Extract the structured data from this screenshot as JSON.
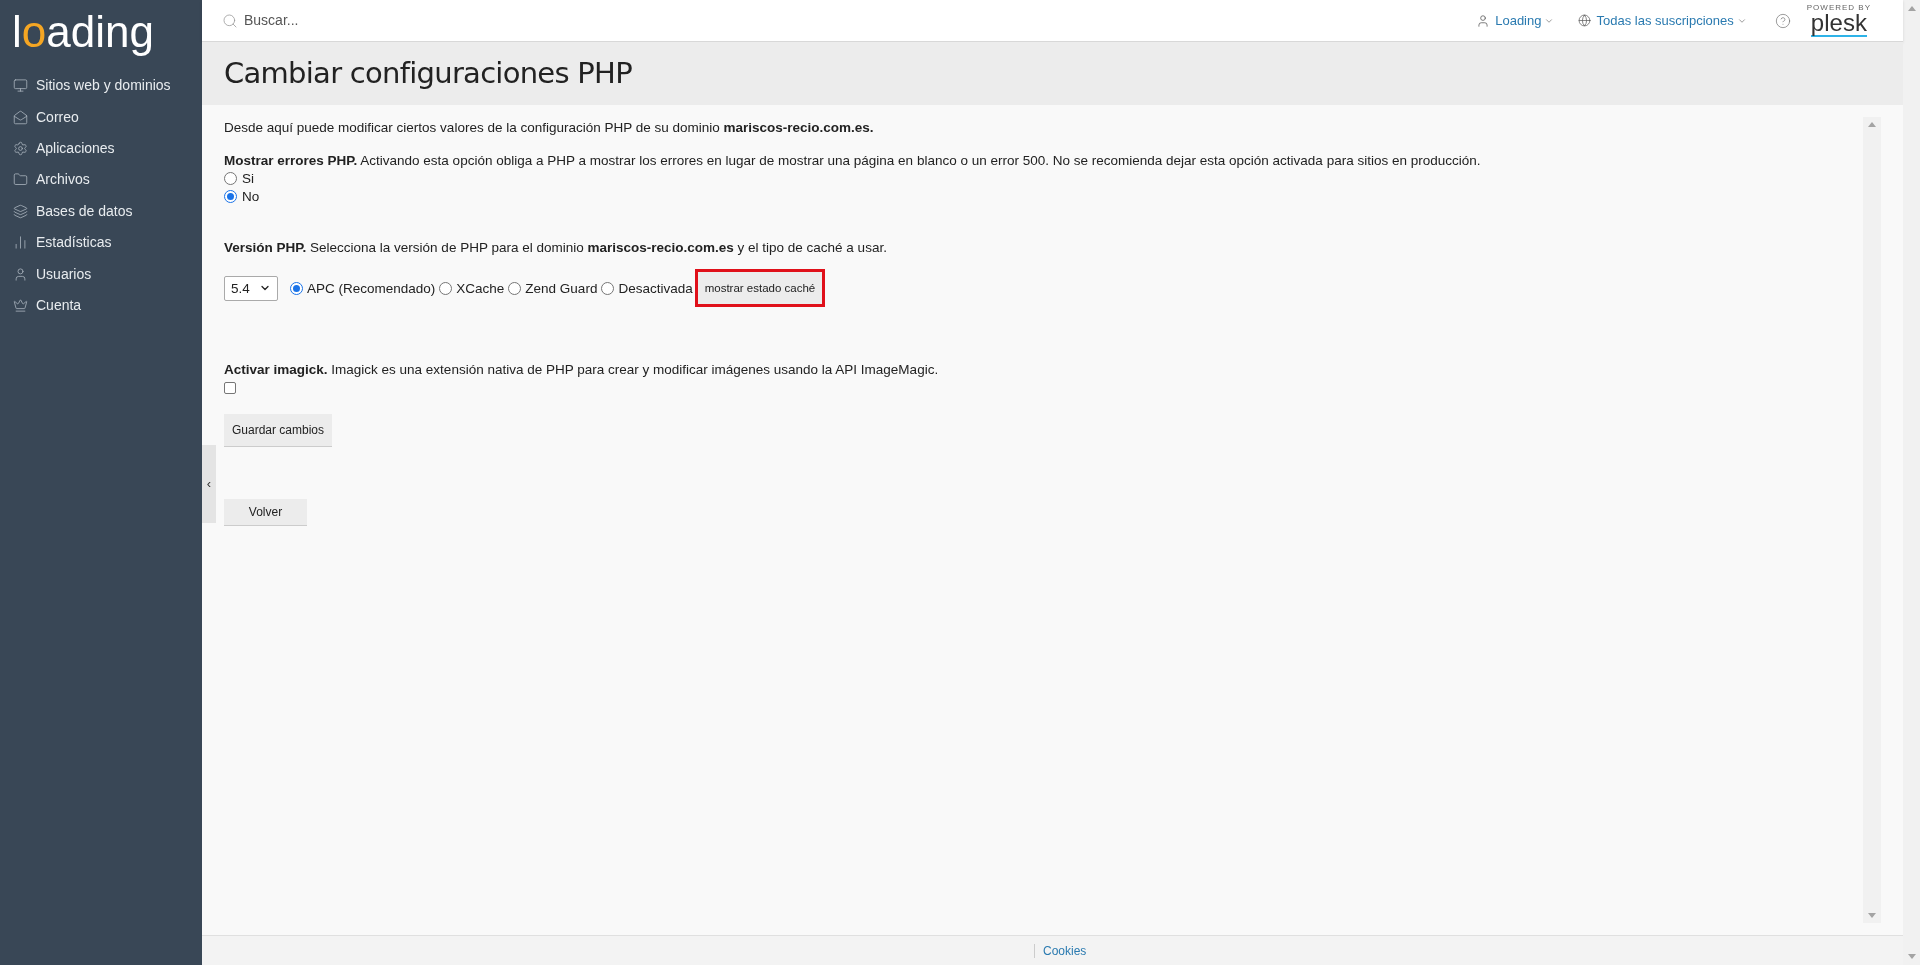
{
  "sidebar": {
    "logo": [
      {
        "text": "l",
        "accent": false
      },
      {
        "text": "o",
        "accent": true
      },
      {
        "text": "ading",
        "accent": false
      }
    ],
    "items": [
      {
        "label": "Sitios web y dominios"
      },
      {
        "label": "Correo"
      },
      {
        "label": "Aplicaciones"
      },
      {
        "label": "Archivos"
      },
      {
        "label": "Bases de datos"
      },
      {
        "label": "Estadísticas"
      },
      {
        "label": "Usuarios"
      },
      {
        "label": "Cuenta"
      }
    ],
    "collapse": "‹"
  },
  "header": {
    "search": {
      "placeholder": "Buscar..."
    },
    "user": "Loading",
    "subscriptions": "Todas las suscripciones",
    "powered_by": "POWERED BY",
    "brand": "plesk"
  },
  "title": "Cambiar configuraciones PHP",
  "intro": "Desde aquí puede modificar ciertos valores de la configuración PHP de su dominio **mariscos-recio.com.es.**",
  "errors": {
    "text": "**Mostrar errores PHP.** Activando esta opción obliga a PHP a mostrar los errores en lugar de mostrar una página en blanco o un error 500. No se recomienda dejar esta opción activada para sitios en producción.",
    "options": [
      {
        "label": "Si",
        "selected": false
      },
      {
        "label": "No",
        "selected": true
      }
    ]
  },
  "version": {
    "text": "**Versión PHP.** Selecciona la versión de PHP para el dominio **mariscos-recio.com.es** y el tipo de caché a usar.",
    "value": "5.4",
    "cache_options": [
      {
        "label": "APC (Recomendado)",
        "selected": true
      },
      {
        "label": "XCache",
        "selected": false
      },
      {
        "label": "Zend Guard",
        "selected": false
      },
      {
        "label": "Desactivada",
        "selected": false
      }
    ],
    "cache_button": {
      "label": "mostrar estado caché",
      "highlighted": true
    }
  },
  "imagick": {
    "text": "**Activar imagick.** Imagick es una extensión nativa de PHP para crear y modificar imágenes usando la API ImageMagic.",
    "checked": false
  },
  "save_button": "Guardar cambios",
  "back_button": "Volver",
  "footer": {
    "link": "Cookies"
  }
}
